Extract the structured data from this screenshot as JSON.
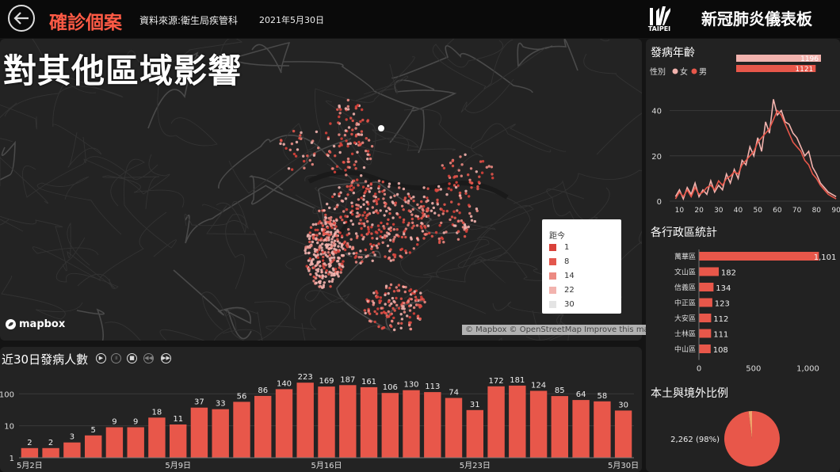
{
  "header": {
    "title": "確診個案",
    "source": "資料來源:衛生局疾管科",
    "date": "2021年5月30日",
    "logo_text": "TAIPEI",
    "dashboard_title": "新冠肺炎儀表板"
  },
  "map": {
    "overlay_title": "對其他區域影響",
    "legend_title": "距今",
    "legend": [
      {
        "label": "1",
        "color": "#d9413a"
      },
      {
        "label": "8",
        "color": "#e3574d"
      },
      {
        "label": "14",
        "color": "#ec8a82"
      },
      {
        "label": "22",
        "color": "#f2b3ae"
      },
      {
        "label": "30",
        "color": "#e4e4e4"
      }
    ],
    "mapbox_label": "mapbox",
    "attribution": "© Mapbox © OpenStreetMap Improve this map"
  },
  "colors": {
    "accent": "#ff5a45",
    "bar": "#e8574a",
    "female": "#f2b3ae",
    "male": "#e8574a"
  },
  "right": {
    "age_title": "發病年齡",
    "gender_label": "性別",
    "female_label": "女",
    "male_label": "男",
    "district_title": "各行政區統計",
    "ratio_title": "本土與境外比例",
    "pie_label": "2,262 (98%)"
  },
  "bottom": {
    "title": "近30日發病人數"
  },
  "chart_data": [
    {
      "type": "bar",
      "title": "近30日發病人數",
      "yscale": "log",
      "yticks": [
        "1",
        "10",
        "100"
      ],
      "xticks": [
        "5月2日",
        "5月9日",
        "5月16日",
        "5月23日",
        "5月30日"
      ],
      "categories": [
        "5/2",
        "5/3",
        "5/4",
        "5/5",
        "5/6",
        "5/7",
        "5/8",
        "5/9",
        "5/10",
        "5/11",
        "5/12",
        "5/13",
        "5/14",
        "5/15",
        "5/16",
        "5/17",
        "5/18",
        "5/19",
        "5/20",
        "5/21",
        "5/22",
        "5/23",
        "5/24",
        "5/25",
        "5/26",
        "5/27",
        "5/28",
        "5/29",
        "5/30"
      ],
      "values": [
        2,
        2,
        3,
        5,
        9,
        9,
        18,
        11,
        37,
        33,
        56,
        86,
        140,
        223,
        169,
        187,
        161,
        106,
        130,
        113,
        74,
        31,
        172,
        181,
        124,
        85,
        64,
        58,
        30
      ]
    },
    {
      "type": "bar",
      "title": "性別",
      "categories": [
        "女",
        "男"
      ],
      "values": [
        1196,
        1121
      ]
    },
    {
      "type": "line",
      "title": "發病年齡",
      "xticks": [
        "10",
        "20",
        "30",
        "40",
        "50",
        "60",
        "70",
        "80",
        "90"
      ],
      "yticks": [
        "0",
        "20",
        "40"
      ],
      "ylim": [
        0,
        50
      ],
      "x": [
        8,
        10,
        12,
        14,
        16,
        18,
        20,
        22,
        24,
        26,
        28,
        30,
        32,
        34,
        36,
        38,
        40,
        42,
        44,
        46,
        48,
        50,
        52,
        54,
        56,
        58,
        60,
        62,
        64,
        66,
        68,
        70,
        72,
        74,
        76,
        78,
        80,
        82,
        84,
        86,
        88,
        90
      ],
      "series": [
        {
          "name": "女",
          "values": [
            2,
            5,
            1,
            6,
            3,
            8,
            2,
            5,
            3,
            9,
            4,
            7,
            5,
            12,
            8,
            14,
            10,
            18,
            16,
            24,
            20,
            28,
            22,
            35,
            30,
            45,
            38,
            40,
            35,
            34,
            30,
            28,
            24,
            20,
            22,
            15,
            12,
            8,
            6,
            4,
            3,
            2
          ]
        },
        {
          "name": "男",
          "values": [
            1,
            4,
            2,
            5,
            2,
            6,
            3,
            4,
            6,
            7,
            5,
            9,
            7,
            10,
            11,
            13,
            12,
            16,
            18,
            20,
            22,
            26,
            28,
            30,
            32,
            36,
            40,
            38,
            34,
            30,
            26,
            24,
            22,
            18,
            16,
            12,
            10,
            7,
            5,
            3,
            2,
            1
          ]
        }
      ]
    },
    {
      "type": "bar",
      "title": "各行政區統計",
      "orientation": "horizontal",
      "categories": [
        "萬華區",
        "文山區",
        "信義區",
        "中正區",
        "大安區",
        "士林區",
        "中山區"
      ],
      "values": [
        1101,
        182,
        134,
        123,
        112,
        111,
        108
      ],
      "data_labels": [
        "1,101",
        "182",
        "134",
        "123",
        "112",
        "111",
        "108"
      ],
      "xticks": [
        "0",
        "500",
        "1,000"
      ],
      "xlim": [
        0,
        1200
      ]
    },
    {
      "type": "pie",
      "title": "本土與境外比例",
      "values": [
        2262,
        46
      ],
      "data_labels": [
        "2,262 (98%)"
      ]
    }
  ]
}
